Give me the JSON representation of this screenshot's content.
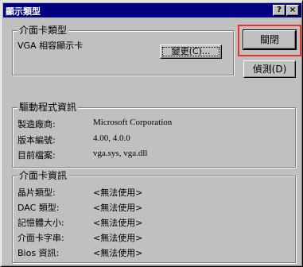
{
  "window": {
    "title": "顯示類型"
  },
  "titlebar_buttons": {
    "help": "?",
    "close": "×"
  },
  "adapter_type": {
    "title": "介面卡類型",
    "name": "VGA 相容顯示卡",
    "change_button": "變更(C)..."
  },
  "buttons": {
    "close": "關閉",
    "detect": "偵測(D)"
  },
  "driver_info": {
    "title": "驅動程式資訊",
    "rows": [
      {
        "label": "製造廠商:",
        "value": "Microsoft Corporation"
      },
      {
        "label": "版本編號:",
        "value": "4.00, 4.0.0"
      },
      {
        "label": "目前檔案:",
        "value": "vga.sys, vga.dll"
      }
    ]
  },
  "adapter_info": {
    "title": "介面卡資訊",
    "rows": [
      {
        "label": "晶片類型:",
        "value": "<無法使用>"
      },
      {
        "label": "DAC 類型:",
        "value": "<無法使用>"
      },
      {
        "label": "記憶體大小:",
        "value": "<無法使用>"
      },
      {
        "label": "介面卡字串:",
        "value": "<無法使用>"
      },
      {
        "label": "Bios 資訊:",
        "value": "<無法使用>"
      }
    ]
  },
  "colors": {
    "titlebar": "#000080",
    "face": "#c0c0c0",
    "highlight_box": "#e8312f"
  }
}
